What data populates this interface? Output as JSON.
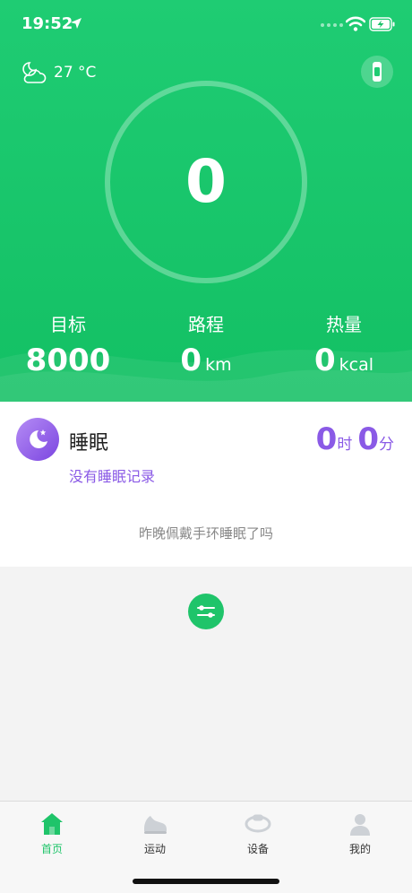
{
  "status_bar": {
    "time": "19:52"
  },
  "weather": {
    "temperature": "27 °C"
  },
  "steps": {
    "count": "0"
  },
  "stats": {
    "goal": {
      "label": "目标",
      "value": "8000"
    },
    "distance": {
      "label": "路程",
      "value": "0",
      "unit": "km"
    },
    "calories": {
      "label": "热量",
      "value": "0",
      "unit": "kcal"
    }
  },
  "sleep": {
    "title": "睡眠",
    "hours": "0",
    "hours_unit": "时",
    "minutes": "0",
    "minutes_unit": "分",
    "no_record": "没有睡眠记录",
    "question": "昨晚佩戴手环睡眠了吗"
  },
  "tabs": [
    {
      "label": "首页",
      "icon": "home-icon",
      "active": true
    },
    {
      "label": "运动",
      "icon": "shoe-icon",
      "active": false
    },
    {
      "label": "设备",
      "icon": "wristband-icon",
      "active": false
    },
    {
      "label": "我的",
      "icon": "person-icon",
      "active": false
    }
  ],
  "colors": {
    "primary_green": "#1fc46a",
    "sleep_purple": "#8a5ae6"
  }
}
